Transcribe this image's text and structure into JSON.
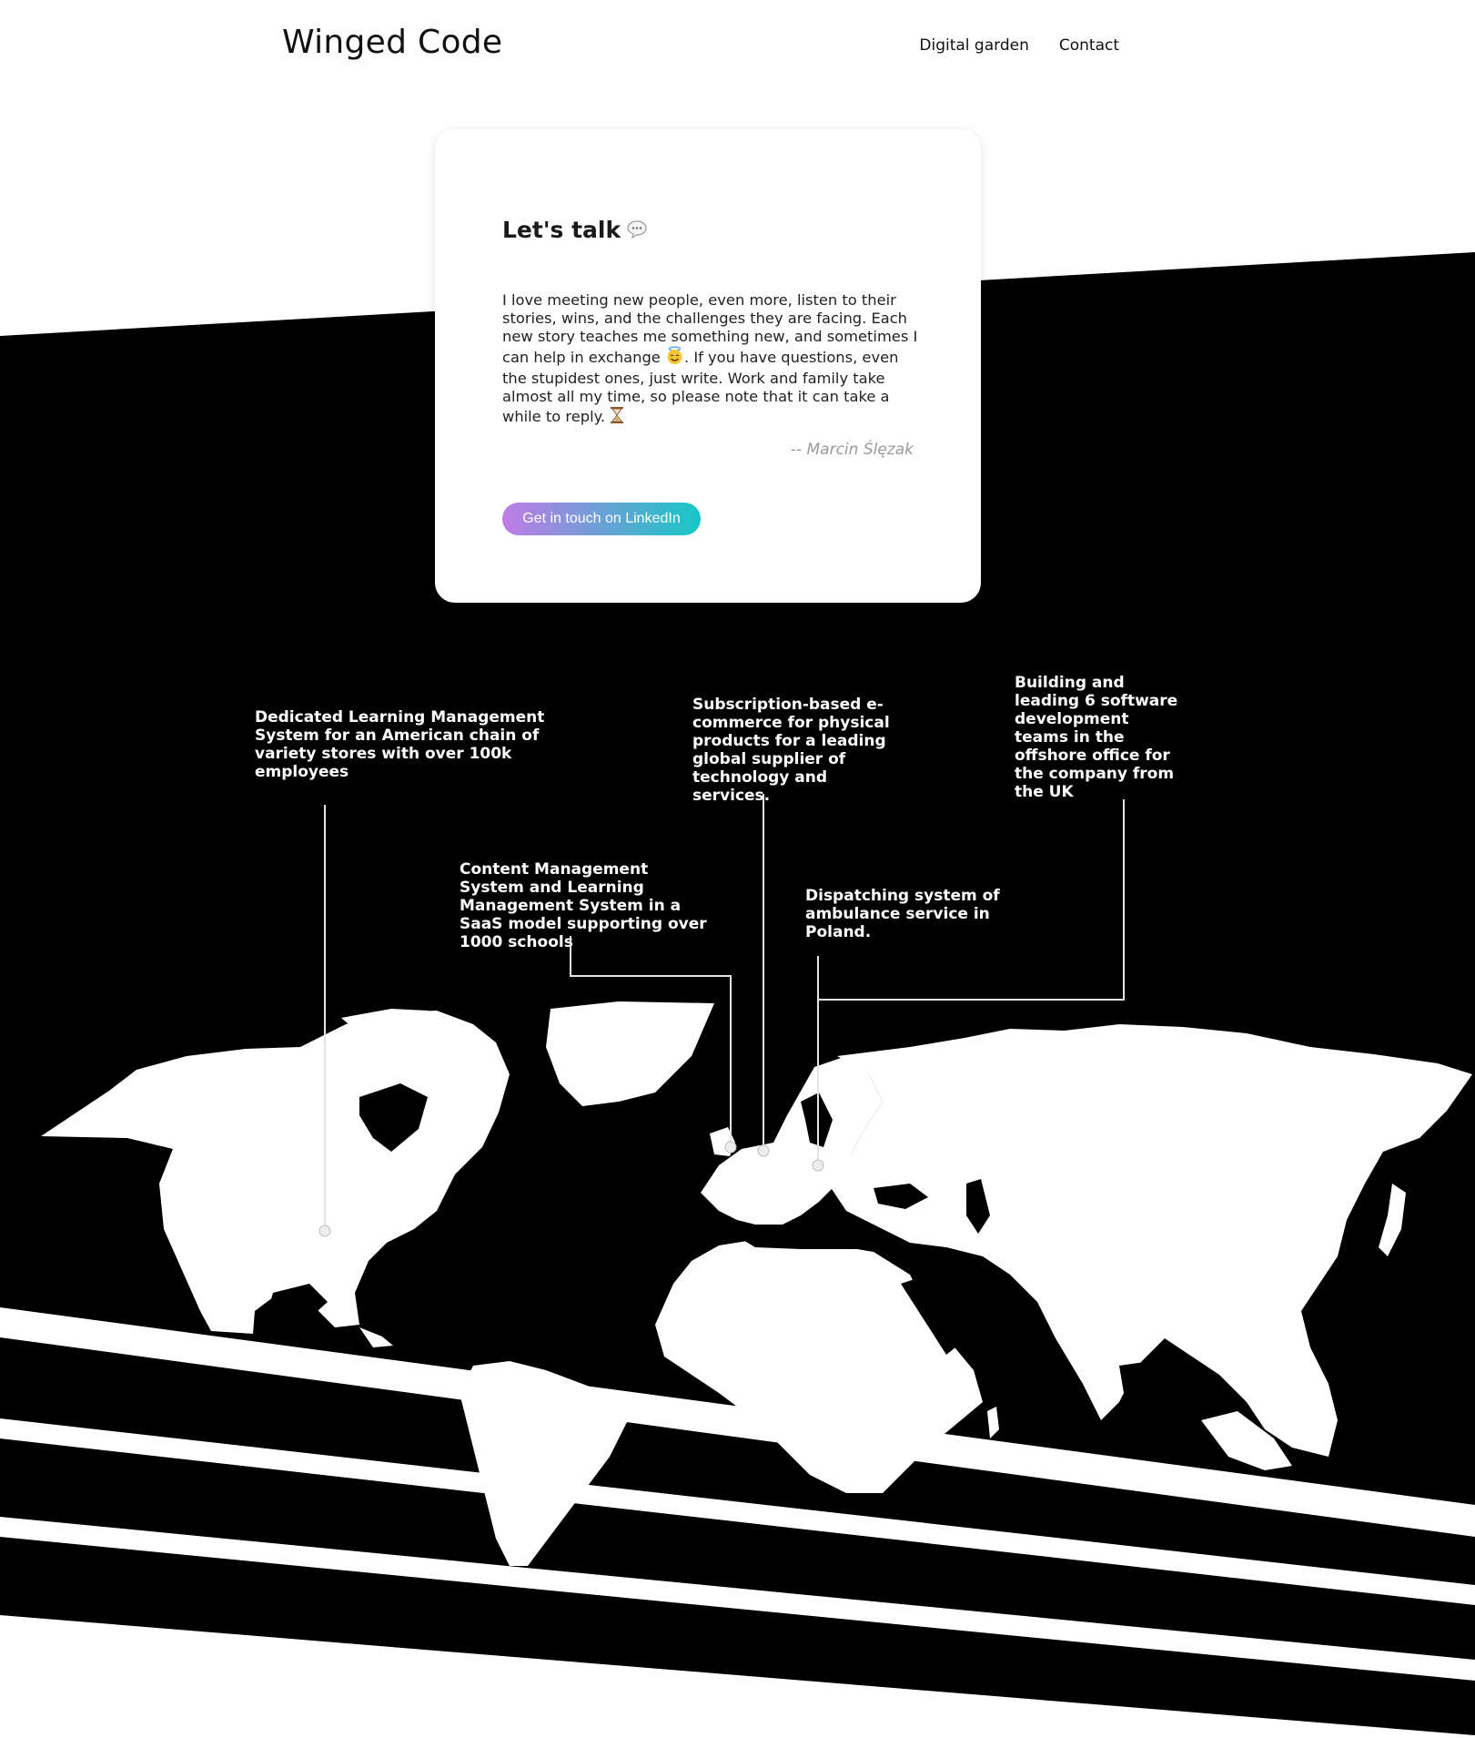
{
  "header": {
    "logo": "Winged Code",
    "nav": [
      "Digital garden",
      "Contact"
    ]
  },
  "contact_card": {
    "title": "Let's talk",
    "body_parts": [
      "I love meeting new people, even more, listen to their stories, wins, and the challenges they are facing. Each new story teaches me something new, and sometimes I can help in exchange ",
      ". If you have questions, even the stupidest ones, just write. Work and family take almost all my time, so please note that it can take a while to reply. "
    ],
    "author": "-- Marcin Ślęzak",
    "button_label": "Get in touch on LinkedIn",
    "icons": [
      "speech-bubble-icon",
      "smiling-angel-icon",
      "hourglass-icon"
    ]
  },
  "projects": [
    {
      "label": "Dedicated Learning Management System for an American chain of variety stores with over 100k employees"
    },
    {
      "label": "Content Management System and Learning Management System in a SaaS model supporting over 1000 schools"
    },
    {
      "label": "Subscription-based e-commerce for physical products for a leading global supplier of technology and services."
    },
    {
      "label": "Dispatching system of ambulance service in Poland."
    },
    {
      "label": "Building and leading 6 software development teams in the offshore office for the company from the UK"
    }
  ],
  "colors": {
    "background": "#000000",
    "accent_gradient_start": "#c07be6",
    "accent_gradient_end": "#16c7c6"
  }
}
